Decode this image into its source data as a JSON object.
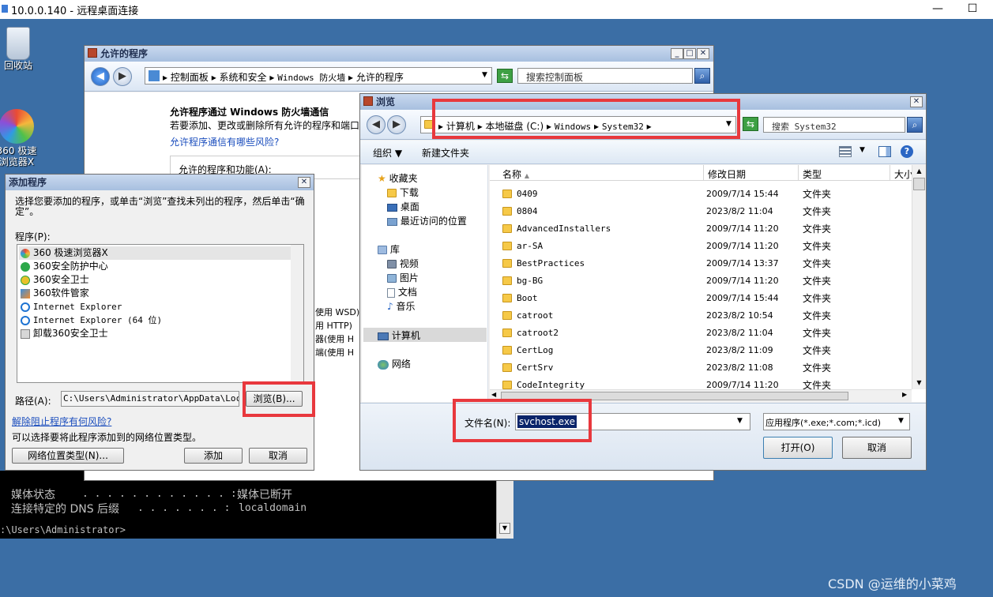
{
  "rdp": {
    "title": "10.0.0.140 - 远程桌面连接",
    "minimize": "—",
    "maximize": "☐"
  },
  "desktop": {
    "recycle_label": "回收站",
    "browser_label": "360 极速浏览器X"
  },
  "console": {
    "line1_label": "媒体状态",
    "line1_dots": ". . . . . . . . . . . . :",
    "line1_value": "媒体已断开",
    "line2_label": "连接特定的 DNS 后缀",
    "line2_dots": ". . . . . . . :",
    "line2_value": "localdomain",
    "prompt": ":\\Users\\Administrator>"
  },
  "allowed": {
    "title": "允许的程序",
    "address": [
      "控制面板",
      "系统和安全",
      "Windows 防火墙",
      "允许的程序"
    ],
    "search_placeholder": "搜索控制面板",
    "heading": "允许程序通过 Windows 防火墙通信",
    "subtext": "若要添加、更改或删除所有允许的程序和端口",
    "risk_link": "允许程序通信有哪些风险?",
    "features_label": "允许的程序和功能(A):",
    "partial_lines": [
      "使用 WSD)",
      "用 HTTP)",
      "器(使用 H",
      "端(使用 H"
    ]
  },
  "add": {
    "title": "添加程序",
    "instruction": "选择您要添加的程序，或单击“浏览”查找未列出的程序，然后单击“确定”。",
    "programs_label": "程序(P):",
    "programs": [
      {
        "icon": "360-browser-icon",
        "name": "360 极速浏览器X",
        "color": "#e94b35"
      },
      {
        "icon": "360-defense-icon",
        "name": "360安全防护中心",
        "color": "#2ca84a"
      },
      {
        "icon": "360-guard-icon",
        "name": "360安全卫士",
        "color": "#2aa53c"
      },
      {
        "icon": "360-softmgr-icon",
        "name": "360软件管家",
        "color": "#3a8fdf"
      },
      {
        "icon": "ie-icon",
        "name": "Internet Explorer",
        "color": "#1e73d2"
      },
      {
        "icon": "ie-icon",
        "name": "Internet Explorer (64 位)",
        "color": "#1e73d2"
      },
      {
        "icon": "uninstall-icon",
        "name": "卸载360安全卫士",
        "color": "#808080"
      }
    ],
    "path_label": "路径(A):",
    "path_value": "C:\\Users\\Administrator\\AppData\\Local\\",
    "browse_label": "浏览(B)...",
    "unblock_link": "解除阻止程序有何风险?",
    "network_hint": "可以选择要将此程序添加到的网络位置类型。",
    "network_button": "网络位置类型(N)...",
    "add_button": "添加",
    "cancel_button": "取消"
  },
  "browse": {
    "title": "浏览",
    "path": [
      "计算机",
      "本地磁盘 (C:)",
      "Windows",
      "System32"
    ],
    "search_placeholder": "搜索 System32",
    "organize": "组织 ▼",
    "new_folder": "新建文件夹",
    "nav": {
      "favorites": "收藏夹",
      "downloads": "下载",
      "desktop": "桌面",
      "recent": "最近访问的位置",
      "library": "库",
      "videos": "视频",
      "pictures": "图片",
      "documents": "文档",
      "music": "音乐",
      "computer": "计算机",
      "network": "网络"
    },
    "columns": {
      "name": "名称",
      "date": "修改日期",
      "type": "类型",
      "size": "大小"
    },
    "rows": [
      {
        "name": "0409",
        "date": "2009/7/14 15:44",
        "type": "文件夹"
      },
      {
        "name": "0804",
        "date": "2023/8/2 11:04",
        "type": "文件夹"
      },
      {
        "name": "AdvancedInstallers",
        "date": "2009/7/14 11:20",
        "type": "文件夹"
      },
      {
        "name": "ar-SA",
        "date": "2009/7/14 11:20",
        "type": "文件夹"
      },
      {
        "name": "BestPractices",
        "date": "2009/7/14 13:37",
        "type": "文件夹"
      },
      {
        "name": "bg-BG",
        "date": "2009/7/14 11:20",
        "type": "文件夹"
      },
      {
        "name": "Boot",
        "date": "2009/7/14 15:44",
        "type": "文件夹"
      },
      {
        "name": "catroot",
        "date": "2023/8/2 10:54",
        "type": "文件夹"
      },
      {
        "name": "catroot2",
        "date": "2023/8/2 11:04",
        "type": "文件夹"
      },
      {
        "name": "CertLog",
        "date": "2023/8/2 11:09",
        "type": "文件夹"
      },
      {
        "name": "CertSrv",
        "date": "2023/8/2 11:08",
        "type": "文件夹"
      },
      {
        "name": "CodeIntegrity",
        "date": "2009/7/14 11:20",
        "type": "文件夹"
      }
    ],
    "filename_label": "文件名(N):",
    "filename_value": "svchost.exe",
    "filter_value": "应用程序(*.exe;*.com;*.icd)",
    "open_button": "打开(O)",
    "cancel_button": "取消"
  },
  "watermark": "CSDN @运维的小菜鸡",
  "colors": {
    "desktop": "#3b6ea5",
    "highlight": "#e8383d",
    "selection": "#0a246a"
  }
}
